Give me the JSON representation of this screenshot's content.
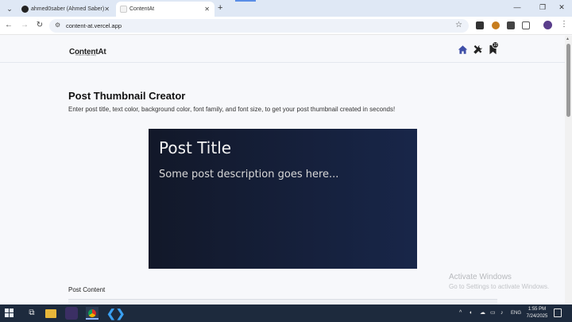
{
  "browser": {
    "tabs": [
      {
        "title": "ahmed0saber (Ahmed Saber)",
        "close": "✕"
      },
      {
        "title": "ContentAt",
        "close": "✕"
      }
    ],
    "new_tab": "+",
    "window_controls": {
      "minimize": "—",
      "maximize": "❐",
      "close": "✕"
    },
    "nav": {
      "back": "←",
      "forward": "→",
      "reload": "↻"
    },
    "url": "content-at.vercel.app",
    "star": "☆",
    "menu": "⋮"
  },
  "site": {
    "logo": {
      "text": "ContentAt",
      "tagline": "Content made easy"
    },
    "header_icons": [
      "home-icon",
      "tools-icon",
      "bookmark-icon"
    ],
    "bookmark_badge": "10"
  },
  "main": {
    "title": "Post Thumbnail Creator",
    "subtitle": "Enter post title, text color, background color, font family, and font size, to get your post thumbnail created in seconds!",
    "thumbnail": {
      "title": "Post Title",
      "description": "Some post description goes here...",
      "bg_from": "#121829",
      "bg_to": "#182649",
      "text_color": "#f2f2f2"
    },
    "content_label": "Post Content"
  },
  "watermark": {
    "line1": "Activate Windows",
    "line2": "Go to Settings to activate Windows."
  },
  "taskbar": {
    "apps": [
      "start-icon",
      "task-view-icon",
      "file-explorer-icon",
      "github-desktop-icon",
      "chrome-icon",
      "vscode-icon"
    ],
    "tray_chevron": "^",
    "language": "ENG",
    "time": "1:55 PM",
    "date": "7/24/2025"
  }
}
